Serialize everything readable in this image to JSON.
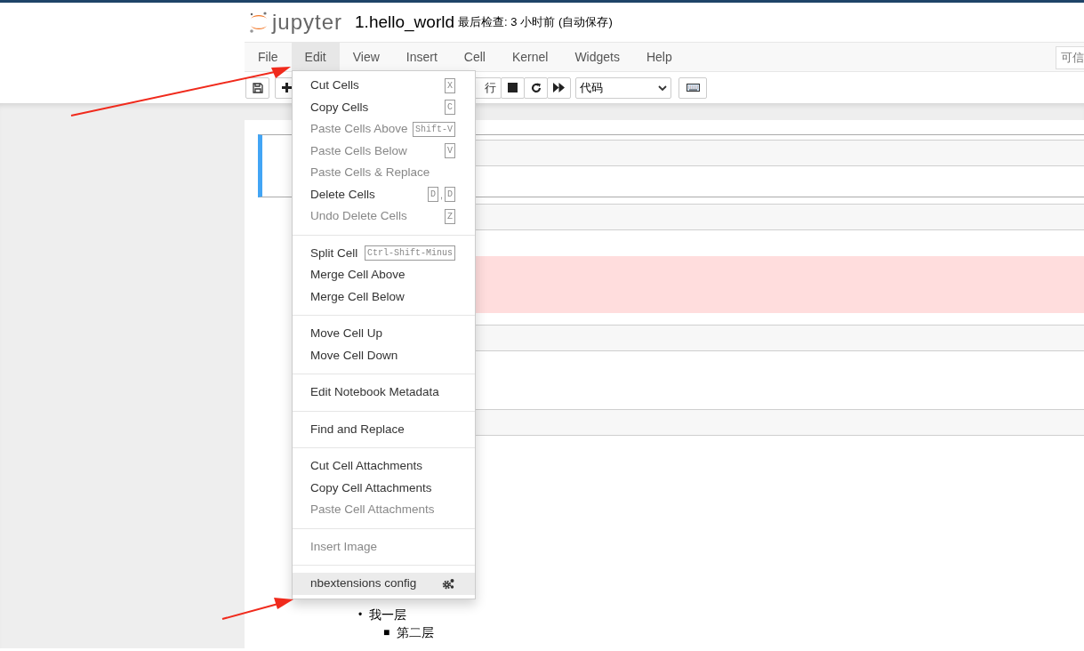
{
  "header": {
    "logo_text": "jupyter",
    "notebook_name": "1.hello_world",
    "checkpoint": "最后检查: 3 小时前",
    "autosave": "(自动保存)"
  },
  "menubar": {
    "items": [
      {
        "label": "File",
        "selected": false
      },
      {
        "label": "Edit",
        "selected": true
      },
      {
        "label": "View",
        "selected": false
      },
      {
        "label": "Insert",
        "selected": false
      },
      {
        "label": "Cell",
        "selected": false
      },
      {
        "label": "Kernel",
        "selected": false
      },
      {
        "label": "Widgets",
        "selected": false
      },
      {
        "label": "Help",
        "selected": false
      }
    ],
    "trusted": "可信"
  },
  "toolbar": {
    "run_label": "行",
    "cell_type": "代码"
  },
  "edit_menu": {
    "groups": [
      [
        {
          "kind": "plain",
          "label": "Cut Cells",
          "disabled": false,
          "highlighted": false,
          "shortcut": [
            "X"
          ]
        },
        {
          "kind": "plain",
          "label": "Copy Cells",
          "disabled": false,
          "highlighted": false,
          "shortcut": [
            "C"
          ]
        },
        {
          "kind": "plain",
          "label": "Paste Cells Above",
          "disabled": true,
          "highlighted": false,
          "shortcut": [
            "Shift-V"
          ]
        },
        {
          "kind": "plain",
          "label": "Paste Cells Below",
          "disabled": true,
          "highlighted": false,
          "shortcut": [
            "V"
          ]
        },
        {
          "kind": "plain",
          "label": "Paste Cells & Replace",
          "disabled": true,
          "highlighted": false
        },
        {
          "kind": "plain",
          "label": "Delete Cells",
          "disabled": false,
          "highlighted": false,
          "shortcut": [
            "D",
            ",",
            "D"
          ]
        },
        {
          "kind": "plain",
          "label": "Undo Delete Cells",
          "disabled": true,
          "highlighted": false,
          "shortcut": [
            "Z"
          ]
        }
      ],
      [
        {
          "kind": "plain",
          "label": "Split Cell",
          "disabled": false,
          "highlighted": false,
          "shortcut": [
            "Ctrl-Shift-Minus"
          ]
        },
        {
          "kind": "plain",
          "label": "Merge Cell Above",
          "disabled": false,
          "highlighted": false
        },
        {
          "kind": "plain",
          "label": "Merge Cell Below",
          "disabled": false,
          "highlighted": false
        }
      ],
      [
        {
          "kind": "plain",
          "label": "Move Cell Up",
          "disabled": false,
          "highlighted": false
        },
        {
          "kind": "plain",
          "label": "Move Cell Down",
          "disabled": false,
          "highlighted": false
        }
      ],
      [
        {
          "kind": "plain",
          "label": "Edit Notebook Metadata",
          "disabled": false,
          "highlighted": false
        }
      ],
      [
        {
          "kind": "plain",
          "label": "Find and Replace",
          "disabled": false,
          "highlighted": false
        }
      ],
      [
        {
          "kind": "plain",
          "label": "Cut Cell Attachments",
          "disabled": false,
          "highlighted": false
        },
        {
          "kind": "plain",
          "label": "Copy Cell Attachments",
          "disabled": false,
          "highlighted": false
        },
        {
          "kind": "plain",
          "label": "Paste Cell Attachments",
          "disabled": true,
          "highlighted": false
        }
      ],
      [
        {
          "kind": "plain",
          "label": "Insert Image",
          "disabled": true,
          "highlighted": false
        }
      ],
      [
        {
          "kind": "settings",
          "label": "nbextensions config",
          "disabled": false,
          "highlighted": true
        }
      ]
    ]
  },
  "cells": [
    {
      "kind": "code",
      "selected": true
    },
    {
      "kind": "code",
      "selected": false,
      "output": {
        "kind": "error"
      }
    },
    {
      "kind": "code",
      "selected": false
    },
    {
      "kind": "code",
      "selected": false
    },
    {
      "kind": "markdown",
      "selected": false,
      "list": [
        {
          "marker": "•",
          "text": "我一层",
          "children": [
            {
              "marker": "■",
              "text": "第二层"
            }
          ]
        }
      ]
    }
  ]
}
